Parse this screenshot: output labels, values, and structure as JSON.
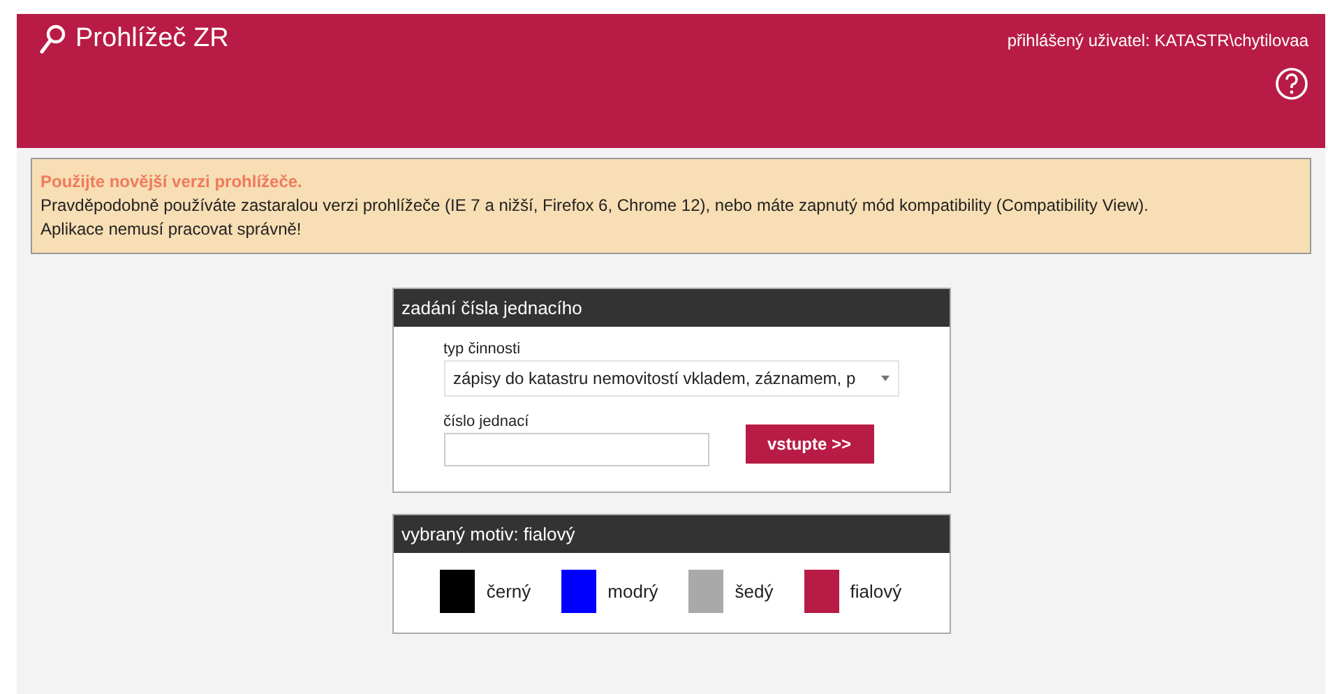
{
  "header": {
    "title": "Prohlížeč ZR",
    "user": "přihlášený uživatel: KATASTR\\chytilovaa"
  },
  "warning": {
    "title": "Použijte novější verzi prohlížeče.",
    "lines": [
      "Pravděpodobně používáte zastaralou verzi prohlížeče (IE 7 a nižší, Firefox 6, Chrome 12), nebo máte zapnutý mód kompatibility (Compatibility View).",
      "Aplikace nemusí pracovat správně!"
    ]
  },
  "entry_panel": {
    "title": "zadání čísla jednacího",
    "activity_label": "typ činnosti",
    "activity_value": "zápisy do katastru nemovitostí vkladem, záznamem, p",
    "number_label": "číslo jednací",
    "submit": "vstupte >>"
  },
  "theme_panel": {
    "title": "vybraný motiv: fialový",
    "themes": [
      {
        "label": "černý",
        "color": "#000000"
      },
      {
        "label": "modrý",
        "color": "#0000ff"
      },
      {
        "label": "šedý",
        "color": "#a9a9a9"
      },
      {
        "label": "fialový",
        "color": "#b81c46"
      }
    ]
  }
}
